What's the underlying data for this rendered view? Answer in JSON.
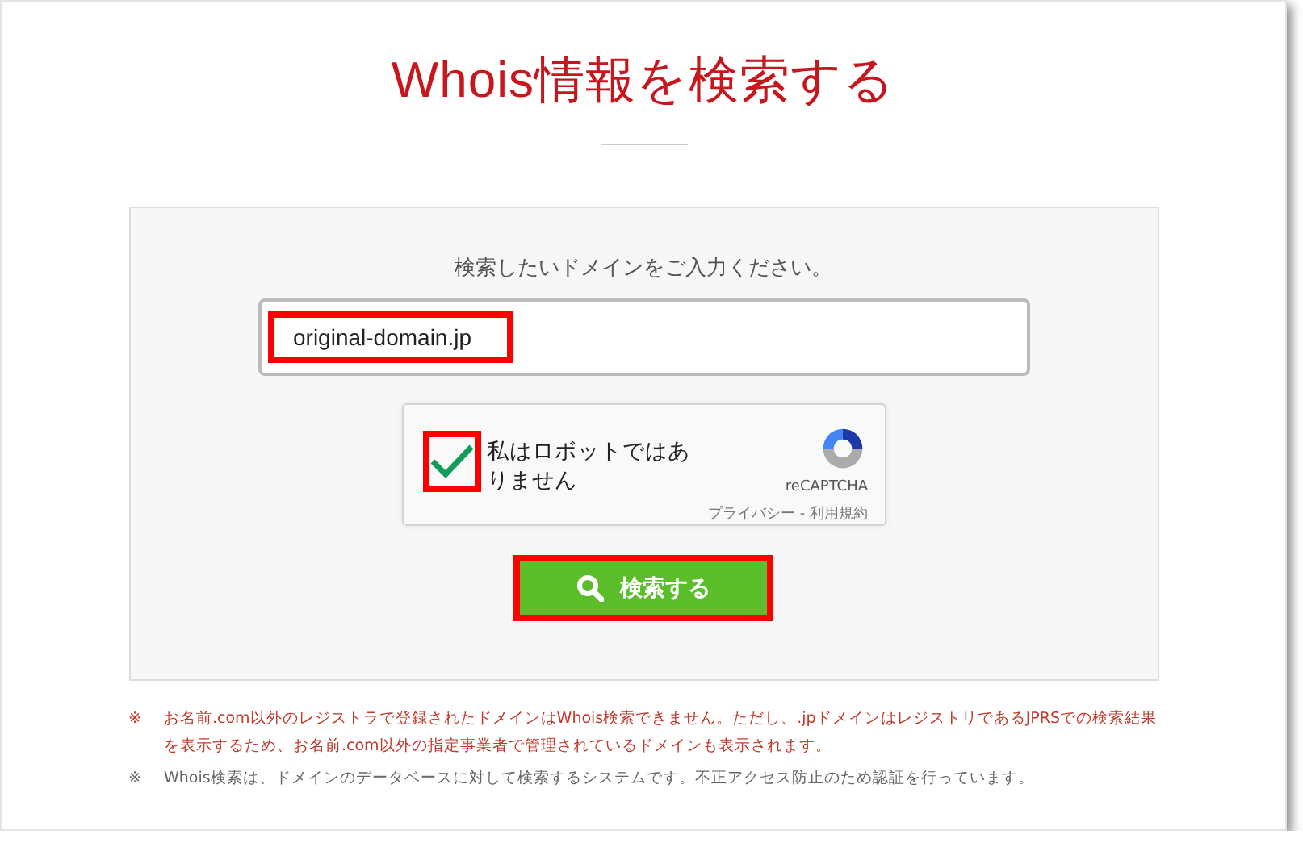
{
  "title": "Whois情報を検索する",
  "form": {
    "prompt": "検索したいドメインをご入力ください。",
    "domain_field": {
      "value": "original-domain.jp",
      "highlighted": true
    },
    "captcha": {
      "label": "私はロボットではありません",
      "checked": true,
      "highlighted": true,
      "brand": "reCAPTCHA",
      "privacy_link": "プライバシー",
      "separator": "-",
      "terms_link": "利用規約"
    },
    "search_button": {
      "label": "検索する",
      "highlighted": true
    }
  },
  "notes": [
    {
      "mark": "※",
      "text": "お名前.com以外のレジストラで登録されたドメインはWhois検索できません。ただし、.jpドメインはレジストリであるJPRSでの検索結果を表示するため、お名前.com以外の指定事業者で管理されているドメインも表示されます。",
      "color": "#c0392b"
    },
    {
      "mark": "※",
      "text": "Whois検索は、ドメインのデータベースに対して検索するシステムです。不正アクセス防止のため認証を行っています。",
      "color": "#666666"
    }
  ]
}
